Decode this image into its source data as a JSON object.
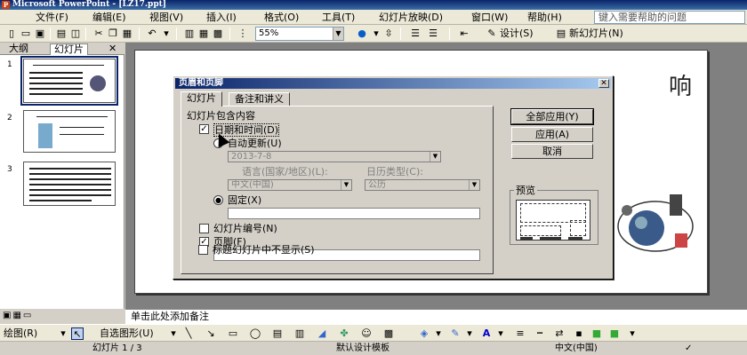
{
  "window": {
    "title": "Microsoft PowerPoint - [LZ17.ppt]"
  },
  "menu": [
    "文件(F)",
    "编辑(E)",
    "视图(V)",
    "插入(I)",
    "格式(O)",
    "工具(T)",
    "幻灯片放映(D)",
    "窗口(W)",
    "帮助(H)"
  ],
  "help_search": {
    "placeholder": "键入需要帮助的问题"
  },
  "toolbar": {
    "zoom": "55%",
    "design_label": "设计(S)",
    "new_slide_label": "新幻灯片(N)"
  },
  "left_panel": {
    "tabs": [
      "大纲",
      "幻灯片"
    ],
    "thumb_numbers": [
      "1",
      "2",
      "3"
    ]
  },
  "slide": {
    "title_fragment": "响"
  },
  "notes": {
    "placeholder": "单击此处添加备注"
  },
  "drawbar": {
    "draw_label": "绘图(R)",
    "autoshapes_label": "自选图形(U)"
  },
  "status": {
    "slide_count": "幻灯片 1 / 3",
    "template": "默认设计模板",
    "language": "中文(中国)"
  },
  "dialog": {
    "title": "页眉和页脚",
    "tabs": [
      "幻灯片",
      "备注和讲义"
    ],
    "group_label": "幻灯片包含内容",
    "date_time": {
      "label": "日期和时间(D)",
      "checked": true
    },
    "auto_update": {
      "label": "自动更新(U)",
      "value": "2013-7-8"
    },
    "language_label": "语言(国家/地区)(L):",
    "language_value": "中文(中国)",
    "calendar_label": "日历类型(C):",
    "calendar_value": "公历",
    "fixed": {
      "label": "固定(X)",
      "selected": true,
      "value": ""
    },
    "slide_number": {
      "label": "幻灯片编号(N)",
      "checked": false
    },
    "footer": {
      "label": "页脚(F)",
      "checked": true,
      "value": ""
    },
    "no_title_slide": {
      "label": "标题幻灯片中不显示(S)",
      "checked": false
    },
    "buttons": {
      "apply_all": "全部应用(Y)",
      "apply": "应用(A)",
      "cancel": "取消"
    },
    "preview_label": "预览"
  }
}
